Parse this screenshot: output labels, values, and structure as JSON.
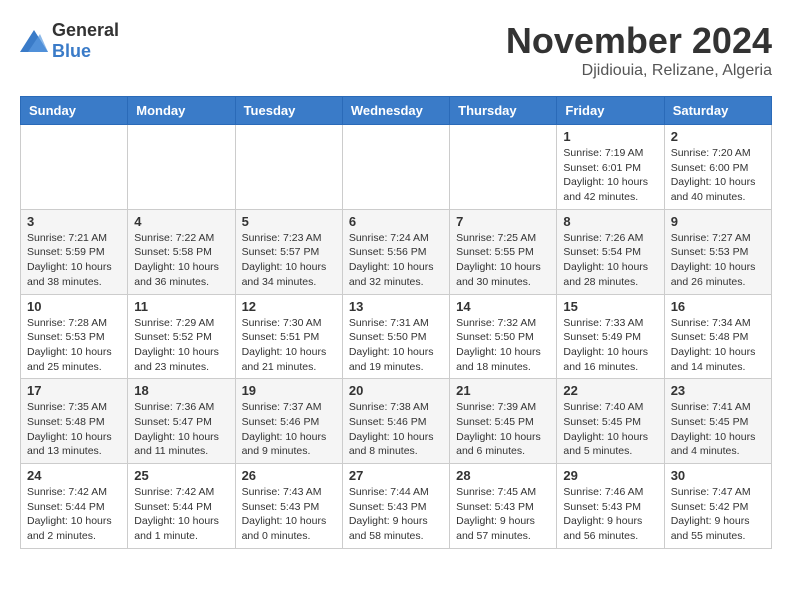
{
  "header": {
    "logo": {
      "general": "General",
      "blue": "Blue"
    },
    "title": "November 2024",
    "location": "Djidiouia, Relizane, Algeria"
  },
  "calendar": {
    "days_of_week": [
      "Sunday",
      "Monday",
      "Tuesday",
      "Wednesday",
      "Thursday",
      "Friday",
      "Saturday"
    ],
    "weeks": [
      [
        {
          "day": "",
          "info": ""
        },
        {
          "day": "",
          "info": ""
        },
        {
          "day": "",
          "info": ""
        },
        {
          "day": "",
          "info": ""
        },
        {
          "day": "",
          "info": ""
        },
        {
          "day": "1",
          "info": "Sunrise: 7:19 AM\nSunset: 6:01 PM\nDaylight: 10 hours\nand 42 minutes."
        },
        {
          "day": "2",
          "info": "Sunrise: 7:20 AM\nSunset: 6:00 PM\nDaylight: 10 hours\nand 40 minutes."
        }
      ],
      [
        {
          "day": "3",
          "info": "Sunrise: 7:21 AM\nSunset: 5:59 PM\nDaylight: 10 hours\nand 38 minutes."
        },
        {
          "day": "4",
          "info": "Sunrise: 7:22 AM\nSunset: 5:58 PM\nDaylight: 10 hours\nand 36 minutes."
        },
        {
          "day": "5",
          "info": "Sunrise: 7:23 AM\nSunset: 5:57 PM\nDaylight: 10 hours\nand 34 minutes."
        },
        {
          "day": "6",
          "info": "Sunrise: 7:24 AM\nSunset: 5:56 PM\nDaylight: 10 hours\nand 32 minutes."
        },
        {
          "day": "7",
          "info": "Sunrise: 7:25 AM\nSunset: 5:55 PM\nDaylight: 10 hours\nand 30 minutes."
        },
        {
          "day": "8",
          "info": "Sunrise: 7:26 AM\nSunset: 5:54 PM\nDaylight: 10 hours\nand 28 minutes."
        },
        {
          "day": "9",
          "info": "Sunrise: 7:27 AM\nSunset: 5:53 PM\nDaylight: 10 hours\nand 26 minutes."
        }
      ],
      [
        {
          "day": "10",
          "info": "Sunrise: 7:28 AM\nSunset: 5:53 PM\nDaylight: 10 hours\nand 25 minutes."
        },
        {
          "day": "11",
          "info": "Sunrise: 7:29 AM\nSunset: 5:52 PM\nDaylight: 10 hours\nand 23 minutes."
        },
        {
          "day": "12",
          "info": "Sunrise: 7:30 AM\nSunset: 5:51 PM\nDaylight: 10 hours\nand 21 minutes."
        },
        {
          "day": "13",
          "info": "Sunrise: 7:31 AM\nSunset: 5:50 PM\nDaylight: 10 hours\nand 19 minutes."
        },
        {
          "day": "14",
          "info": "Sunrise: 7:32 AM\nSunset: 5:50 PM\nDaylight: 10 hours\nand 18 minutes."
        },
        {
          "day": "15",
          "info": "Sunrise: 7:33 AM\nSunset: 5:49 PM\nDaylight: 10 hours\nand 16 minutes."
        },
        {
          "day": "16",
          "info": "Sunrise: 7:34 AM\nSunset: 5:48 PM\nDaylight: 10 hours\nand 14 minutes."
        }
      ],
      [
        {
          "day": "17",
          "info": "Sunrise: 7:35 AM\nSunset: 5:48 PM\nDaylight: 10 hours\nand 13 minutes."
        },
        {
          "day": "18",
          "info": "Sunrise: 7:36 AM\nSunset: 5:47 PM\nDaylight: 10 hours\nand 11 minutes."
        },
        {
          "day": "19",
          "info": "Sunrise: 7:37 AM\nSunset: 5:46 PM\nDaylight: 10 hours\nand 9 minutes."
        },
        {
          "day": "20",
          "info": "Sunrise: 7:38 AM\nSunset: 5:46 PM\nDaylight: 10 hours\nand 8 minutes."
        },
        {
          "day": "21",
          "info": "Sunrise: 7:39 AM\nSunset: 5:45 PM\nDaylight: 10 hours\nand 6 minutes."
        },
        {
          "day": "22",
          "info": "Sunrise: 7:40 AM\nSunset: 5:45 PM\nDaylight: 10 hours\nand 5 minutes."
        },
        {
          "day": "23",
          "info": "Sunrise: 7:41 AM\nSunset: 5:45 PM\nDaylight: 10 hours\nand 4 minutes."
        }
      ],
      [
        {
          "day": "24",
          "info": "Sunrise: 7:42 AM\nSunset: 5:44 PM\nDaylight: 10 hours\nand 2 minutes."
        },
        {
          "day": "25",
          "info": "Sunrise: 7:42 AM\nSunset: 5:44 PM\nDaylight: 10 hours\nand 1 minute."
        },
        {
          "day": "26",
          "info": "Sunrise: 7:43 AM\nSunset: 5:43 PM\nDaylight: 10 hours\nand 0 minutes."
        },
        {
          "day": "27",
          "info": "Sunrise: 7:44 AM\nSunset: 5:43 PM\nDaylight: 9 hours\nand 58 minutes."
        },
        {
          "day": "28",
          "info": "Sunrise: 7:45 AM\nSunset: 5:43 PM\nDaylight: 9 hours\nand 57 minutes."
        },
        {
          "day": "29",
          "info": "Sunrise: 7:46 AM\nSunset: 5:43 PM\nDaylight: 9 hours\nand 56 minutes."
        },
        {
          "day": "30",
          "info": "Sunrise: 7:47 AM\nSunset: 5:42 PM\nDaylight: 9 hours\nand 55 minutes."
        }
      ]
    ]
  }
}
